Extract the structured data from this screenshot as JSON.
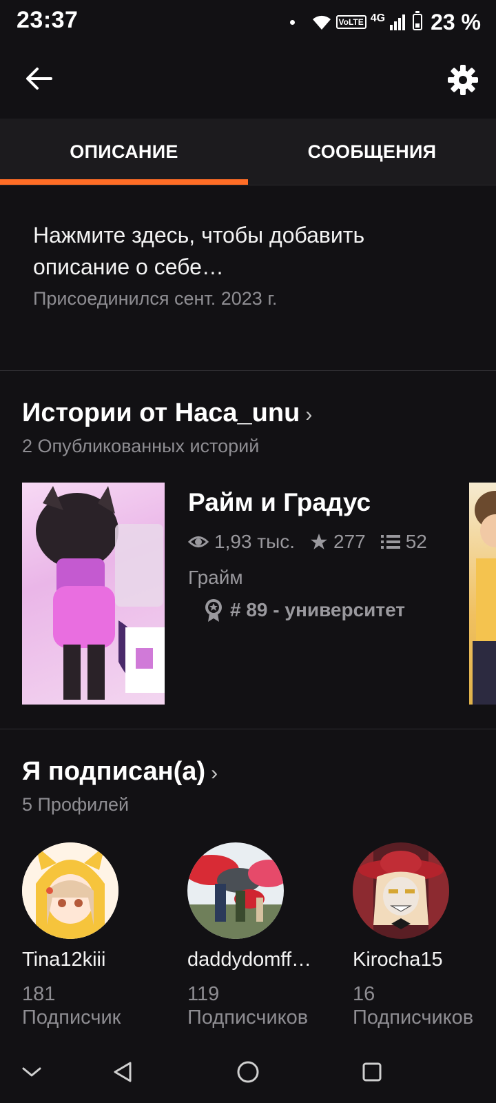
{
  "status_bar": {
    "time": "23:37",
    "network": "4G",
    "volte": "VoLTE",
    "battery": "23 %"
  },
  "toolbar": {
    "back_icon": "arrow-left-icon",
    "settings_icon": "gear-icon"
  },
  "tabs": [
    {
      "label": "ОПИСАНИЕ",
      "active": true
    },
    {
      "label": "СООБЩЕНИЯ",
      "active": false
    }
  ],
  "accent_color": "#ff6d26",
  "about": {
    "prompt": "Нажмите здесь, чтобы добавить описание о себе…",
    "joined": "Присоединился сент. 2023 г."
  },
  "stories_section": {
    "title": "Истории от Haca_unu",
    "subtitle": "2 Опубликованных историй",
    "story": {
      "title": "Райм и Градус",
      "views": "1,93 тыс.",
      "votes": "277",
      "parts": "52",
      "genre": "Грайм",
      "rank": "# 89 - университет"
    }
  },
  "following_section": {
    "title": "Я подписан(а)",
    "subtitle": "5 Профилей",
    "profiles": [
      {
        "name": "Tina12kiii",
        "count": "181",
        "label": "Подписчик"
      },
      {
        "name": "daddydomff…",
        "count": "119",
        "label": "Подписчиков"
      },
      {
        "name": "Kirocha15",
        "count": "16",
        "label": "Подписчиков"
      }
    ]
  },
  "nav_bar": {
    "icons": [
      "chevron-down-icon",
      "back-triangle-icon",
      "home-circle-icon",
      "recents-square-icon"
    ]
  }
}
